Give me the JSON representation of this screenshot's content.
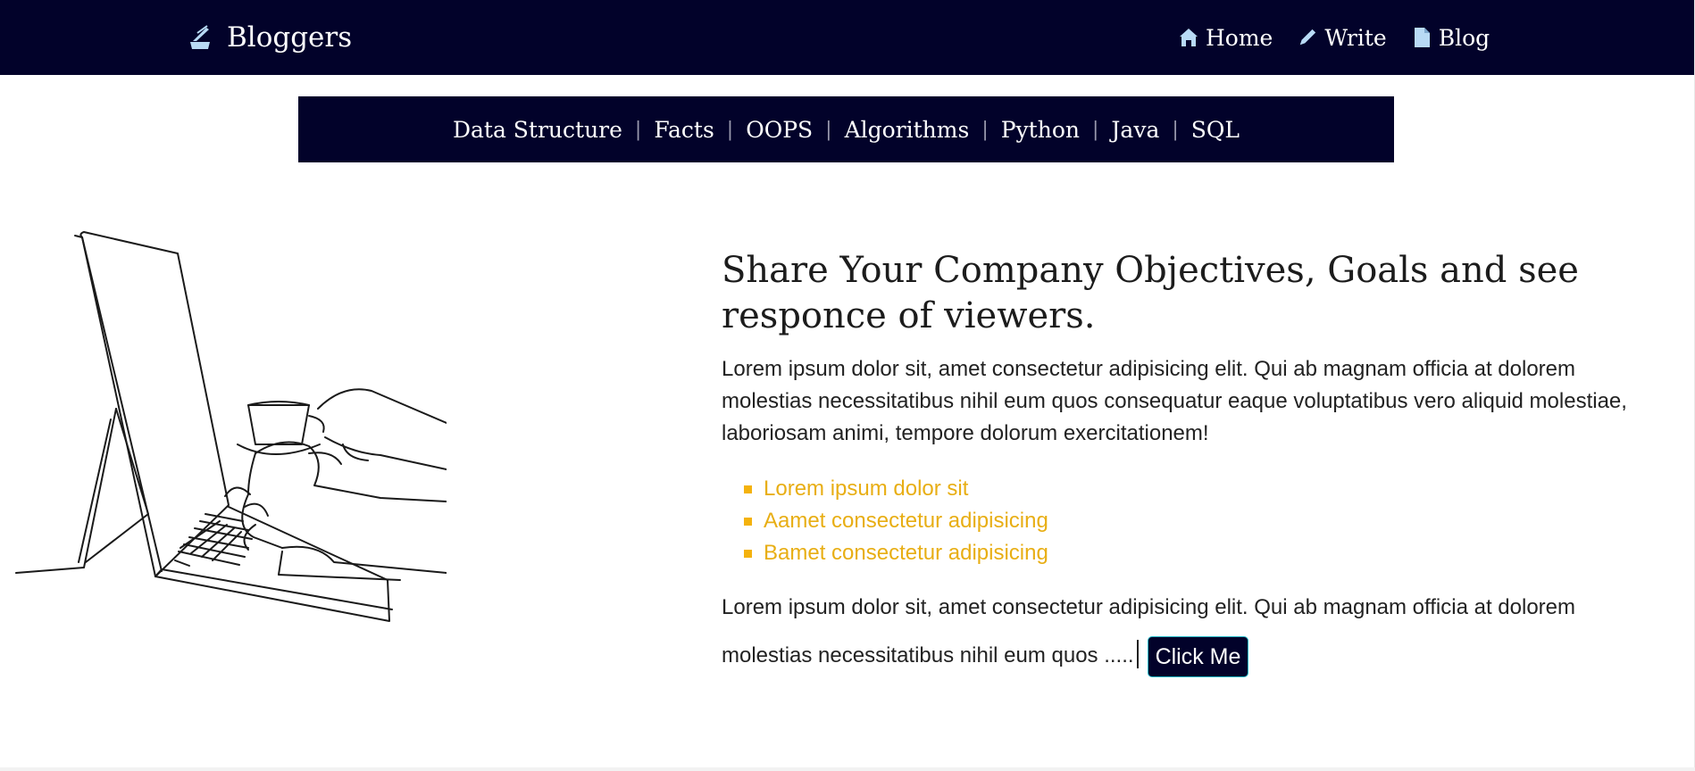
{
  "header": {
    "brand": "Bloggers",
    "nav": [
      {
        "label": "Home",
        "icon": "home-icon"
      },
      {
        "label": "Write",
        "icon": "pen-icon"
      },
      {
        "label": "Blog",
        "icon": "document-icon"
      }
    ]
  },
  "categories": [
    "Data Structure",
    "Facts",
    "OOPS",
    "Algorithms",
    "Python",
    "Java",
    "SQL"
  ],
  "hero": {
    "headline": "Share Your Company Objectives, Goals and see responce of viewers.",
    "paragraph": "Lorem ipsum dolor sit, amet consectetur adipisicing elit. Qui ab magnam officia at dolorem molestias necessitatibus nihil eum quos consequatur eaque voluptatibus vero aliquid molestiae, laboriosam animi, tempore dolorum exercitationem!",
    "bullets": [
      "Lorem ipsum dolor sit",
      "Aamet consectetur adipisicing",
      "Bamet consectetur adipisicing"
    ],
    "paragraph2": "Lorem ipsum dolor sit, amet consectetur adipisicing elit. Qui ab magnam officia at dolorem molestias necessitatibus nihil eum quos .....",
    "button_label": "Click Me"
  },
  "colors": {
    "navy": "#02022a",
    "accent_yellow": "#e8ae14",
    "button_border": "#22b7c4",
    "icon_light_blue": "#b8daf5"
  }
}
